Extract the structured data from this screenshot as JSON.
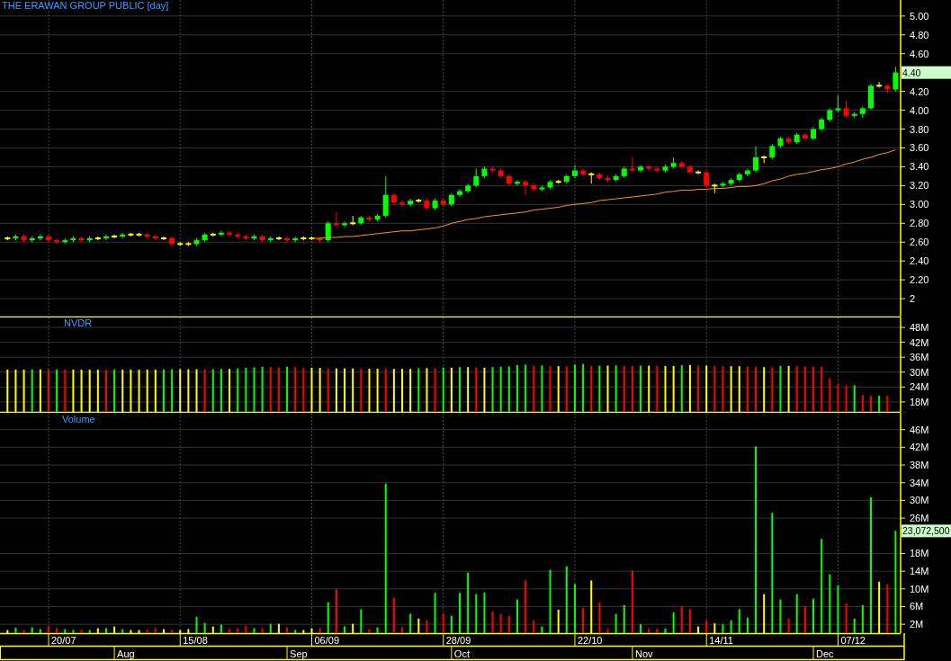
{
  "title": "THE ERAWAN GROUP PUBLIC [day]",
  "price_panel": {
    "last_value_label": "4.40",
    "chart_data": {
      "type": "candlestick",
      "grid": true,
      "ylim": [
        1.81,
        5.17
      ],
      "yticks": [
        {
          "value": 5,
          "label": "5.00"
        },
        {
          "value": 4.8,
          "label": "4.80"
        },
        {
          "value": 4.6,
          "label": "4.60"
        },
        {
          "value": 4.2,
          "label": "4.20"
        },
        {
          "value": 4,
          "label": "4.00"
        },
        {
          "value": 3.8,
          "label": "3.80"
        },
        {
          "value": 3.6,
          "label": "3.60"
        },
        {
          "value": 3.4,
          "label": "3.40"
        },
        {
          "value": 3.2,
          "label": "3.20"
        },
        {
          "value": 3,
          "label": "3.00"
        },
        {
          "value": 2.8,
          "label": "2.80"
        },
        {
          "value": 2.6,
          "label": "2.60"
        },
        {
          "value": 2.4,
          "label": "2.40"
        },
        {
          "value": 2.2,
          "label": "2.20"
        },
        {
          "value": 2,
          "label": "2"
        }
      ],
      "ohlc": [
        [
          2.64,
          2.66,
          2.62,
          2.64
        ],
        [
          2.64,
          2.68,
          2.62,
          2.66
        ],
        [
          2.66,
          2.68,
          2.6,
          2.62
        ],
        [
          2.62,
          2.66,
          2.6,
          2.64
        ],
        [
          2.64,
          2.68,
          2.62,
          2.66
        ],
        [
          2.66,
          2.68,
          2.6,
          2.62
        ],
        [
          2.62,
          2.64,
          2.58,
          2.6
        ],
        [
          2.6,
          2.64,
          2.58,
          2.62
        ],
        [
          2.62,
          2.66,
          2.6,
          2.64
        ],
        [
          2.64,
          2.66,
          2.6,
          2.62
        ],
        [
          2.62,
          2.66,
          2.6,
          2.64
        ],
        [
          2.64,
          2.66,
          2.62,
          2.64
        ],
        [
          2.64,
          2.68,
          2.62,
          2.66
        ],
        [
          2.66,
          2.68,
          2.64,
          2.66
        ],
        [
          2.66,
          2.7,
          2.64,
          2.68
        ],
        [
          2.68,
          2.7,
          2.66,
          2.68
        ],
        [
          2.68,
          2.7,
          2.66,
          2.68
        ],
        [
          2.68,
          2.7,
          2.64,
          2.66
        ],
        [
          2.66,
          2.68,
          2.62,
          2.64
        ],
        [
          2.64,
          2.66,
          2.62,
          2.64
        ],
        [
          2.64,
          2.66,
          2.56,
          2.58
        ],
        [
          2.58,
          2.6,
          2.56,
          2.58
        ],
        [
          2.58,
          2.6,
          2.56,
          2.58
        ],
        [
          2.58,
          2.64,
          2.56,
          2.62
        ],
        [
          2.62,
          2.7,
          2.6,
          2.68
        ],
        [
          2.68,
          2.7,
          2.66,
          2.68
        ],
        [
          2.68,
          2.72,
          2.66,
          2.7
        ],
        [
          2.7,
          2.72,
          2.66,
          2.68
        ],
        [
          2.68,
          2.7,
          2.64,
          2.66
        ],
        [
          2.66,
          2.68,
          2.62,
          2.64
        ],
        [
          2.64,
          2.68,
          2.62,
          2.66
        ],
        [
          2.66,
          2.68,
          2.6,
          2.62
        ],
        [
          2.62,
          2.66,
          2.6,
          2.64
        ],
        [
          2.64,
          2.66,
          2.62,
          2.64
        ],
        [
          2.64,
          2.66,
          2.6,
          2.62
        ],
        [
          2.62,
          2.66,
          2.6,
          2.64
        ],
        [
          2.64,
          2.66,
          2.62,
          2.64
        ],
        [
          2.64,
          2.66,
          2.62,
          2.64
        ],
        [
          2.64,
          2.66,
          2.6,
          2.62
        ],
        [
          2.62,
          2.82,
          2.6,
          2.8
        ],
        [
          2.8,
          2.92,
          2.76,
          2.78
        ],
        [
          2.78,
          2.82,
          2.76,
          2.8
        ],
        [
          2.8,
          2.88,
          2.78,
          2.8
        ],
        [
          2.8,
          2.88,
          2.78,
          2.86
        ],
        [
          2.86,
          2.88,
          2.82,
          2.84
        ],
        [
          2.84,
          2.9,
          2.82,
          2.88
        ],
        [
          2.88,
          3.3,
          2.86,
          3.1
        ],
        [
          3.1,
          3.12,
          3.0,
          3.02
        ],
        [
          3.02,
          3.04,
          2.98,
          3.0
        ],
        [
          3.0,
          3.06,
          2.98,
          3.04
        ],
        [
          3.04,
          3.06,
          3.02,
          3.04
        ],
        [
          3.04,
          3.06,
          2.94,
          2.96
        ],
        [
          2.96,
          3.06,
          2.94,
          3.04
        ],
        [
          3.04,
          3.06,
          2.98,
          3.0
        ],
        [
          3.0,
          3.12,
          2.98,
          3.1
        ],
        [
          3.1,
          3.16,
          3.08,
          3.14
        ],
        [
          3.14,
          3.22,
          3.12,
          3.2
        ],
        [
          3.2,
          3.38,
          3.18,
          3.3
        ],
        [
          3.3,
          3.4,
          3.28,
          3.38
        ],
        [
          3.38,
          3.4,
          3.34,
          3.36
        ],
        [
          3.36,
          3.38,
          3.28,
          3.3
        ],
        [
          3.3,
          3.32,
          3.2,
          3.22
        ],
        [
          3.22,
          3.26,
          3.2,
          3.24
        ],
        [
          3.24,
          3.26,
          3.1,
          3.2
        ],
        [
          3.2,
          3.22,
          3.14,
          3.16
        ],
        [
          3.16,
          3.2,
          3.14,
          3.18
        ],
        [
          3.18,
          3.26,
          3.16,
          3.24
        ],
        [
          3.24,
          3.26,
          3.22,
          3.24
        ],
        [
          3.24,
          3.32,
          3.22,
          3.3
        ],
        [
          3.3,
          3.42,
          3.28,
          3.36
        ],
        [
          3.36,
          3.38,
          3.3,
          3.32
        ],
        [
          3.32,
          3.34,
          3.22,
          3.32
        ],
        [
          3.32,
          3.34,
          3.26,
          3.28
        ],
        [
          3.28,
          3.3,
          3.24,
          3.26
        ],
        [
          3.26,
          3.32,
          3.24,
          3.3
        ],
        [
          3.3,
          3.4,
          3.28,
          3.38
        ],
        [
          3.38,
          3.5,
          3.34,
          3.36
        ],
        [
          3.36,
          3.42,
          3.34,
          3.4
        ],
        [
          3.4,
          3.42,
          3.36,
          3.38
        ],
        [
          3.38,
          3.4,
          3.34,
          3.36
        ],
        [
          3.36,
          3.42,
          3.34,
          3.4
        ],
        [
          3.4,
          3.5,
          3.38,
          3.44
        ],
        [
          3.44,
          3.46,
          3.38,
          3.4
        ],
        [
          3.4,
          3.42,
          3.32,
          3.34
        ],
        [
          3.34,
          3.36,
          3.32,
          3.34
        ],
        [
          3.34,
          3.36,
          3.18,
          3.2
        ],
        [
          3.2,
          3.22,
          3.12,
          3.2
        ],
        [
          3.2,
          3.24,
          3.18,
          3.22
        ],
        [
          3.22,
          3.28,
          3.2,
          3.26
        ],
        [
          3.26,
          3.34,
          3.24,
          3.32
        ],
        [
          3.32,
          3.38,
          3.3,
          3.36
        ],
        [
          3.36,
          3.62,
          3.34,
          3.5
        ],
        [
          3.5,
          3.52,
          3.44,
          3.5
        ],
        [
          3.5,
          3.64,
          3.48,
          3.62
        ],
        [
          3.62,
          3.72,
          3.6,
          3.7
        ],
        [
          3.7,
          3.72,
          3.64,
          3.66
        ],
        [
          3.66,
          3.76,
          3.64,
          3.74
        ],
        [
          3.74,
          3.76,
          3.68,
          3.7
        ],
        [
          3.7,
          3.82,
          3.68,
          3.8
        ],
        [
          3.8,
          3.92,
          3.78,
          3.9
        ],
        [
          3.9,
          4.02,
          3.88,
          4.0
        ],
        [
          4.0,
          4.16,
          3.98,
          4.02
        ],
        [
          4.02,
          4.1,
          3.92,
          3.94
        ],
        [
          3.94,
          3.98,
          3.92,
          3.96
        ],
        [
          3.96,
          4.04,
          3.92,
          4.02
        ],
        [
          4.02,
          4.28,
          4.0,
          4.26
        ],
        [
          4.26,
          4.3,
          4.24,
          4.26
        ],
        [
          4.26,
          4.28,
          4.18,
          4.22
        ],
        [
          4.22,
          4.46,
          4.2,
          4.4
        ]
      ],
      "series": [
        {
          "type": "line",
          "color": "#ff9900",
          "values": [
            null,
            null,
            null,
            null,
            null,
            null,
            null,
            null,
            null,
            null,
            null,
            null,
            null,
            null,
            null,
            null,
            null,
            null,
            null,
            null,
            null,
            null,
            null,
            null,
            null,
            null,
            null,
            null,
            null,
            null,
            null,
            null,
            null,
            null,
            null,
            null,
            null,
            2.64,
            2.64,
            2.65,
            2.65,
            2.66,
            2.66,
            2.67,
            2.68,
            2.69,
            2.7,
            2.71,
            2.72,
            2.72,
            2.73,
            2.74,
            2.75,
            2.77,
            2.8,
            2.82,
            2.84,
            2.85,
            2.87,
            2.88,
            2.89,
            2.9,
            2.91,
            2.92,
            2.94,
            2.95,
            2.96,
            2.97,
            2.99,
            3.0,
            3.01,
            3.02,
            3.04,
            3.05,
            3.06,
            3.07,
            3.08,
            3.09,
            3.1,
            3.11,
            3.13,
            3.14,
            3.15,
            3.15,
            3.16,
            3.16,
            3.17,
            3.17,
            3.18,
            3.19,
            3.19,
            3.2,
            3.22,
            3.25,
            3.27,
            3.3,
            3.32,
            3.33,
            3.35,
            3.37,
            3.38,
            3.4,
            3.43,
            3.45,
            3.48,
            3.5,
            3.53,
            3.55,
            3.58
          ]
        }
      ]
    }
  },
  "nvdr_panel": {
    "chart_data": {
      "type": "bar",
      "grid": true,
      "ylim": [
        14,
        52
      ],
      "yticks": [
        {
          "value": 48,
          "label": "48M"
        },
        {
          "value": 42,
          "label": "42M"
        },
        {
          "value": 36,
          "label": "36M"
        },
        {
          "value": 30,
          "label": "30M"
        },
        {
          "value": 24,
          "label": "24M"
        },
        {
          "value": 18,
          "label": "18M"
        }
      ],
      "series": [
        {
          "name": "NVDR",
          "values": [
            31.0,
            31.0,
            31.0,
            31.1,
            31.1,
            31.0,
            31.1,
            31.0,
            31.0,
            31.0,
            31.0,
            31.0,
            30.9,
            31.0,
            31.0,
            31.0,
            31.0,
            31.0,
            31.0,
            31.1,
            31.2,
            31.2,
            31.2,
            31.2,
            31.1,
            31.2,
            31.3,
            31.3,
            31.5,
            31.7,
            31.9,
            32.2,
            32.0,
            31.8,
            32.2,
            31.9,
            31.7,
            31.7,
            31.7,
            31.5,
            31.5,
            31.5,
            31.5,
            31.4,
            31.4,
            31.4,
            31.3,
            31.3,
            31.3,
            31.3,
            31.6,
            31.6,
            31.5,
            31.8,
            31.8,
            32.0,
            32.0,
            31.8,
            31.8,
            32.0,
            32.2,
            32.3,
            32.8,
            33.0,
            32.6,
            32.7,
            32.4,
            32.4,
            32.3,
            33.0,
            33.3,
            32.5,
            32.6,
            32.6,
            32.7,
            32.5,
            32.4,
            32.6,
            32.6,
            32.5,
            32.5,
            32.5,
            32.8,
            32.8,
            32.6,
            32.6,
            32.5,
            32.4,
            32.4,
            32.4,
            32.2,
            32.0,
            32.0,
            31.9,
            32.5,
            32.5,
            32.4,
            32.3,
            32.2,
            32.1,
            27.5,
            25.3,
            24.6,
            24.7,
            20.8,
            20.4,
            20.5,
            20.4,
            null
          ]
        }
      ]
    }
  },
  "volume_panel": {
    "last_value_label": "23,072,500",
    "chart_data": {
      "type": "bar",
      "grid": true,
      "ylim": [
        0,
        49.8
      ],
      "yticks": [
        {
          "value": 46,
          "label": "46M"
        },
        {
          "value": 42,
          "label": "42M"
        },
        {
          "value": 38,
          "label": "38M"
        },
        {
          "value": 34,
          "label": "34M"
        },
        {
          "value": 30,
          "label": "30M"
        },
        {
          "value": 26,
          "label": "26M"
        },
        {
          "value": 18,
          "label": "18M"
        },
        {
          "value": 14,
          "label": "14M"
        },
        {
          "value": 10,
          "label": "10M"
        },
        {
          "value": 6,
          "label": "6M"
        },
        {
          "value": 2,
          "label": "2M"
        }
      ],
      "series": [
        {
          "name": "Volume",
          "values": [
            0.7,
            1.2,
            0.7,
            1.3,
            0.9,
            1.5,
            1.1,
            0.9,
            0.7,
            0.7,
            0.7,
            1.1,
            1.1,
            1.5,
            0.9,
            0.7,
            0.7,
            0.7,
            1.1,
            0.9,
            0.7,
            0.7,
            0.9,
            3.7,
            2.3,
            1.5,
            1.9,
            0.9,
            1.1,
            1.7,
            1.1,
            1.1,
            2.1,
            2.1,
            1.3,
            0.7,
            0.7,
            1.1,
            1.1,
            7.0,
            9.9,
            1.5,
            2.1,
            5.4,
            0.9,
            1.3,
            33.8,
            8.0,
            1.3,
            4.4,
            3.3,
            2.9,
            9.1,
            4.4,
            3.9,
            9.1,
            13.7,
            8.8,
            9.2,
            4.9,
            4.3,
            3.9,
            7.6,
            11.9,
            2.9,
            1.5,
            14.3,
            5.3,
            15.1,
            11.1,
            5.7,
            11.9,
            6.9,
            0.9,
            4.3,
            6.3,
            14.1,
            2.0,
            1.0,
            1.0,
            1.0,
            4.7,
            6.1,
            5.4,
            1.5,
            2.9,
            2.2,
            2.0,
            2.9,
            5.4,
            3.5,
            42.2,
            8.8,
            27.2,
            7.6,
            3.3,
            8.8,
            6.1,
            7.8,
            21.3,
            13.3,
            10.8,
            6.7,
            3.3,
            6.3,
            30.7,
            11.6,
            11.0,
            23.1
          ]
        }
      ]
    }
  },
  "time_axis": {
    "dates": [
      "20/07",
      "15/08",
      "06/09",
      "28/09",
      "22/10",
      "14/11",
      "07/12"
    ],
    "months": [
      "Aug",
      "Sep",
      "Oct",
      "Nov",
      "Dec"
    ]
  }
}
